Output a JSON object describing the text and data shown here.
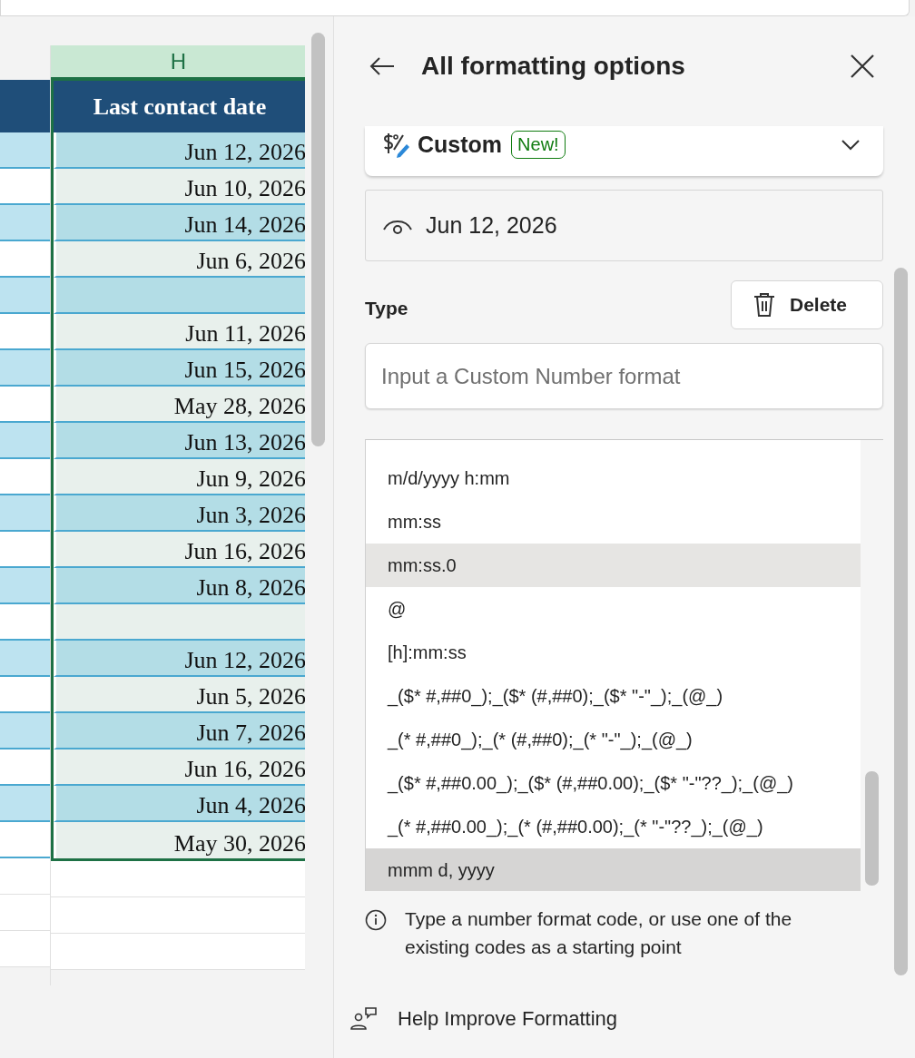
{
  "sheet": {
    "column_letter": "H",
    "header": "Last contact date",
    "rows": [
      {
        "date": "Jun 12, 2026"
      },
      {
        "date": "Jun 10, 2026"
      },
      {
        "date": "Jun 14, 2026"
      },
      {
        "date": "Jun 6, 2026"
      },
      {},
      {
        "date": "Jun 11, 2026"
      },
      {
        "date": "Jun 15, 2026"
      },
      {
        "date": "May 28, 2026"
      },
      {
        "date": "Jun 13, 2026"
      },
      {
        "date": "Jun 9, 2026"
      },
      {
        "date": "Jun 3, 2026"
      },
      {
        "date": "Jun 16, 2026"
      },
      {
        "date": "Jun 8, 2026"
      },
      {},
      {
        "date": "Jun 12, 2026"
      },
      {
        "date": "Jun 5, 2026"
      },
      {
        "date": "Jun 7, 2026"
      },
      {
        "date": "Jun 16, 2026"
      },
      {
        "date": "Jun 4, 2026"
      },
      {
        "date": "May 30, 2026"
      }
    ]
  },
  "panel": {
    "title": "All formatting options",
    "category": {
      "label": "Custom",
      "badge": "New!"
    },
    "preview": "Jun 12, 2026",
    "type_label": "Type",
    "delete_button": "Delete",
    "input": {
      "placeholder": "Input a Custom Number format"
    },
    "formats": [
      {
        "code": "m/d/yyyy h:mm",
        "selected": false,
        "hovered": false
      },
      {
        "code": "mm:ss",
        "selected": false,
        "hovered": false
      },
      {
        "code": "mm:ss.0",
        "selected": false,
        "hovered": true
      },
      {
        "code": "@",
        "selected": false,
        "hovered": false
      },
      {
        "code": "[h]:mm:ss",
        "selected": false,
        "hovered": false
      },
      {
        "code": "_($* #,##0_);_($* (#,##0);_($* \"-\"_);_(@_)",
        "selected": false,
        "hovered": false
      },
      {
        "code": "_(* #,##0_);_(* (#,##0);_(* \"-\"_);_(@_)",
        "selected": false,
        "hovered": false
      },
      {
        "code": "_($* #,##0.00_);_($* (#,##0.00);_($* \"-\"??_);_(@_)",
        "selected": false,
        "hovered": false
      },
      {
        "code": "_(* #,##0.00_);_(* (#,##0.00);_(* \"-\"??_);_(@_)",
        "selected": false,
        "hovered": false
      },
      {
        "code": "mmm d, yyyy",
        "selected": true,
        "hovered": false
      }
    ],
    "hint": "Type a number format code, or use one of the existing codes as a starting point",
    "feedback": "Help Improve Formatting"
  }
}
